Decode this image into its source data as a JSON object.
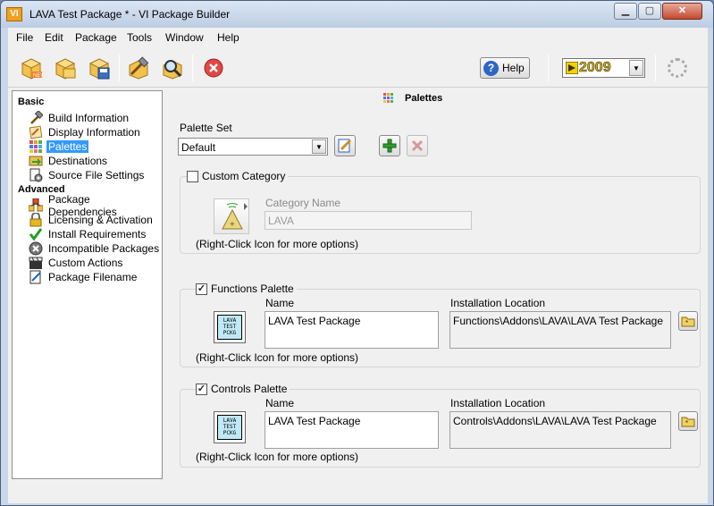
{
  "window": {
    "title": "LAVA Test Package * - VI Package Builder",
    "app_icon": "VI"
  },
  "menu": [
    "File",
    "Edit",
    "Package",
    "Tools",
    "Window",
    "Help"
  ],
  "toolbar": {
    "icons": [
      "new-package-icon",
      "open-package-icon",
      "save-package-icon",
      "build-icon",
      "inspect-icon",
      "close-icon"
    ],
    "help_label": "Help",
    "version": "2009"
  },
  "sidebar": {
    "basic_header": "Basic",
    "basic_items": [
      {
        "label": "Build Information",
        "icon": "hammer-icon"
      },
      {
        "label": "Display Information",
        "icon": "display-icon"
      },
      {
        "label": "Palettes",
        "icon": "palette-icon",
        "selected": true
      },
      {
        "label": "Destinations",
        "icon": "destinations-icon"
      },
      {
        "label": "Source File Settings",
        "icon": "source-files-icon"
      }
    ],
    "advanced_header": "Advanced",
    "advanced_items": [
      {
        "label": "Package Dependencies",
        "icon": "dependencies-icon"
      },
      {
        "label": "Licensing & Activation",
        "icon": "lock-icon"
      },
      {
        "label": "Install Requirements",
        "icon": "checkmark-icon"
      },
      {
        "label": "Incompatible Packages",
        "icon": "incompatible-icon"
      },
      {
        "label": "Custom Actions",
        "icon": "clapper-icon"
      },
      {
        "label": "Package Filename",
        "icon": "filename-icon"
      }
    ]
  },
  "main": {
    "section_title": "Palettes",
    "palette_set_label": "Palette Set",
    "palette_set_value": "Default",
    "custom_category": {
      "label": "Custom Category",
      "checked": false,
      "category_name_label": "Category Name",
      "category_name_value": "LAVA",
      "hint": "(Right-Click Icon for more options)"
    },
    "functions_palette": {
      "label": "Functions Palette",
      "checked": true,
      "name_label": "Name",
      "name_value": "LAVA Test Package",
      "location_label": "Installation Location",
      "location_value": "Functions\\Addons\\LAVA\\LAVA Test Package",
      "icon_text": [
        "LAVA",
        "TEST",
        "PCKG"
      ],
      "hint": "(Right-Click Icon for more options)"
    },
    "controls_palette": {
      "label": "Controls Palette",
      "checked": true,
      "name_label": "Name",
      "name_value": "LAVA Test Package",
      "location_label": "Installation Location",
      "location_value": "Controls\\Addons\\LAVA\\LAVA Test Package",
      "icon_text": [
        "LAVA",
        "TEST",
        "PCKG"
      ],
      "hint": "(Right-Click Icon for more options)"
    }
  }
}
